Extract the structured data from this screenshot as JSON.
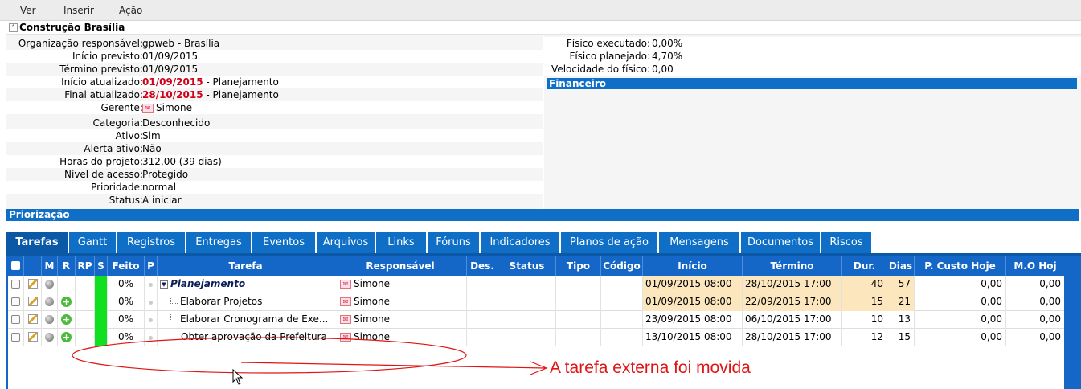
{
  "menu": [
    "Ver",
    "Inserir",
    "Ação"
  ],
  "project": {
    "title": "Construção Brasília",
    "fields": [
      {
        "label": "Organização responsável:",
        "value": "gpweb - Brasília"
      },
      {
        "label": "Início previsto:",
        "value": "01/09/2015"
      },
      {
        "label": "Término previsto:",
        "value": "01/09/2015"
      },
      {
        "label": "Início atualizado:",
        "date": "01/09/2015",
        "suffix": " - Planejamento"
      },
      {
        "label": "Final atualizado:",
        "date": "28/10/2015",
        "suffix": " - Planejamento"
      },
      {
        "label": "Gerente:",
        "value": "Simone"
      },
      {
        "label": "Categoria:",
        "value": "Desconhecido"
      },
      {
        "label": "Ativo:",
        "value": "Sim"
      },
      {
        "label": "Alerta ativo:",
        "value": "Não"
      },
      {
        "label": "Horas do projeto:",
        "value": "312,00 (39 dias)"
      },
      {
        "label": "Nível de acesso:",
        "value": "Protegido"
      },
      {
        "label": "Prioridade:",
        "value": "normal"
      },
      {
        "label": "Status:",
        "value": "A iniciar"
      }
    ],
    "right_fields": [
      {
        "label": "Físico executado:",
        "value": "0,00%"
      },
      {
        "label": "Físico planejado:",
        "value": "4,70%"
      },
      {
        "label": "Velocidade do físico:",
        "value": "0,00"
      }
    ],
    "financeiro_label": "Financeiro",
    "priorizacao_label": "Priorização"
  },
  "tabs": [
    "Tarefas",
    "Gantt",
    "Registros",
    "Entregas",
    "Eventos",
    "Arquivos",
    "Links",
    "Fóruns",
    "Indicadores",
    "Planos de ação",
    "Mensagens",
    "Documentos",
    "Riscos"
  ],
  "table": {
    "headers": [
      "M",
      "R",
      "RP",
      "S",
      "Feito",
      "P",
      "Tarefa",
      "Responsável",
      "Des.",
      "Status",
      "Tipo",
      "Código",
      "Início",
      "Término",
      "Dur.",
      "Dias",
      "P. Custo Hoje",
      "M.O Hoj"
    ],
    "rows": [
      {
        "feito": "0%",
        "tarefa": "Planejamento",
        "responsavel": "Simone",
        "inicio": "01/09/2015 08:00",
        "termino": "28/10/2015 17:00",
        "dur": "40",
        "dias": "57",
        "custo": "0,00",
        "mo": "0,00"
      },
      {
        "feito": "0%",
        "tarefa": "Elaborar Projetos",
        "responsavel": "Simone",
        "inicio": "01/09/2015 08:00",
        "termino": "22/09/2015 17:00",
        "dur": "15",
        "dias": "21",
        "custo": "0,00",
        "mo": "0,00"
      },
      {
        "feito": "0%",
        "tarefa": "Elaborar Cronograma de Exe...",
        "responsavel": "Simone",
        "inicio": "23/09/2015 08:00",
        "termino": "06/10/2015 17:00",
        "dur": "10",
        "dias": "13",
        "custo": "0,00",
        "mo": "0,00"
      },
      {
        "feito": "0%",
        "tarefa": "Obter aprovação da Prefeitura",
        "responsavel": "Simone",
        "inicio": "13/10/2015 08:00",
        "termino": "28/10/2015 17:00",
        "dur": "12",
        "dias": "15",
        "custo": "0,00",
        "mo": "0,00"
      }
    ]
  },
  "annotation": "A tarefa externa foi movida",
  "colors": {
    "tab_blue": "#0f6fc6",
    "status_green": "#10e020",
    "date_highlight": "#fbe6bd",
    "annotation_red": "#e01414"
  }
}
